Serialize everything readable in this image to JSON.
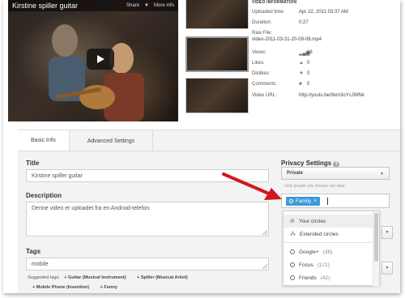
{
  "player": {
    "title": "Kirstine spiller guitar",
    "share_label": "Share",
    "more_info_label": "More info"
  },
  "video_info": {
    "heading": "VIDEO INFORMATION",
    "uploaded_label": "Uploaded time:",
    "uploaded_value": "Apr 22, 2011 03:37 AM",
    "duration_label": "Duration:",
    "duration_value": "0:27",
    "raw_file_label": "Raw File:",
    "raw_file_value": "video-2011-03-31-20-09-08.mp4",
    "views_label": "Views:",
    "views_value": "18",
    "likes_label": "Likes:",
    "likes_value": "0",
    "dislikes_label": "Dislikes:",
    "dislikes_value": "0",
    "comments_label": "Comments:",
    "comments_value": "0",
    "url_label": "Video URL:",
    "url_value": "http://youtu.be/9xm3oYcJWNk"
  },
  "tabs": [
    {
      "label": "Basic Info",
      "active": true
    },
    {
      "label": "Advanced Settings",
      "active": false
    }
  ],
  "form": {
    "title_label": "Title",
    "title_value": "Kirstine spiller guitar",
    "description_label": "Description",
    "description_value": "Denne video er uploadet fra en Android-telefon.",
    "tags_label": "Tags",
    "tags_value": "mobile",
    "suggested_label": "Suggested tags:",
    "suggested_tags": [
      "+ Guitar (Musical Instrument)",
      "+ Spiller (Musical Artist)",
      "+ Mobile Phone (Invention)",
      "+ Funny"
    ]
  },
  "privacy": {
    "label": "Privacy Settings",
    "selected": "Private",
    "help_text": "Only people you choose can view",
    "chip_label": "Family",
    "chip_remove": "×"
  },
  "share_dropdown": {
    "items": [
      {
        "label": "Your circles",
        "count": "",
        "icon": "circles-icon"
      },
      {
        "label": "Extended circles",
        "count": "",
        "icon": "extended-circles-icon"
      },
      {
        "label": "Google+",
        "count": "(36)",
        "icon": "circle-icon"
      },
      {
        "label": "Focus",
        "count": "(121)",
        "icon": "circle-icon"
      },
      {
        "label": "Friends",
        "count": "(42)",
        "icon": "circle-icon"
      }
    ]
  },
  "colors": {
    "chip": "#3d9bd8",
    "arrow": "#d0191c"
  }
}
